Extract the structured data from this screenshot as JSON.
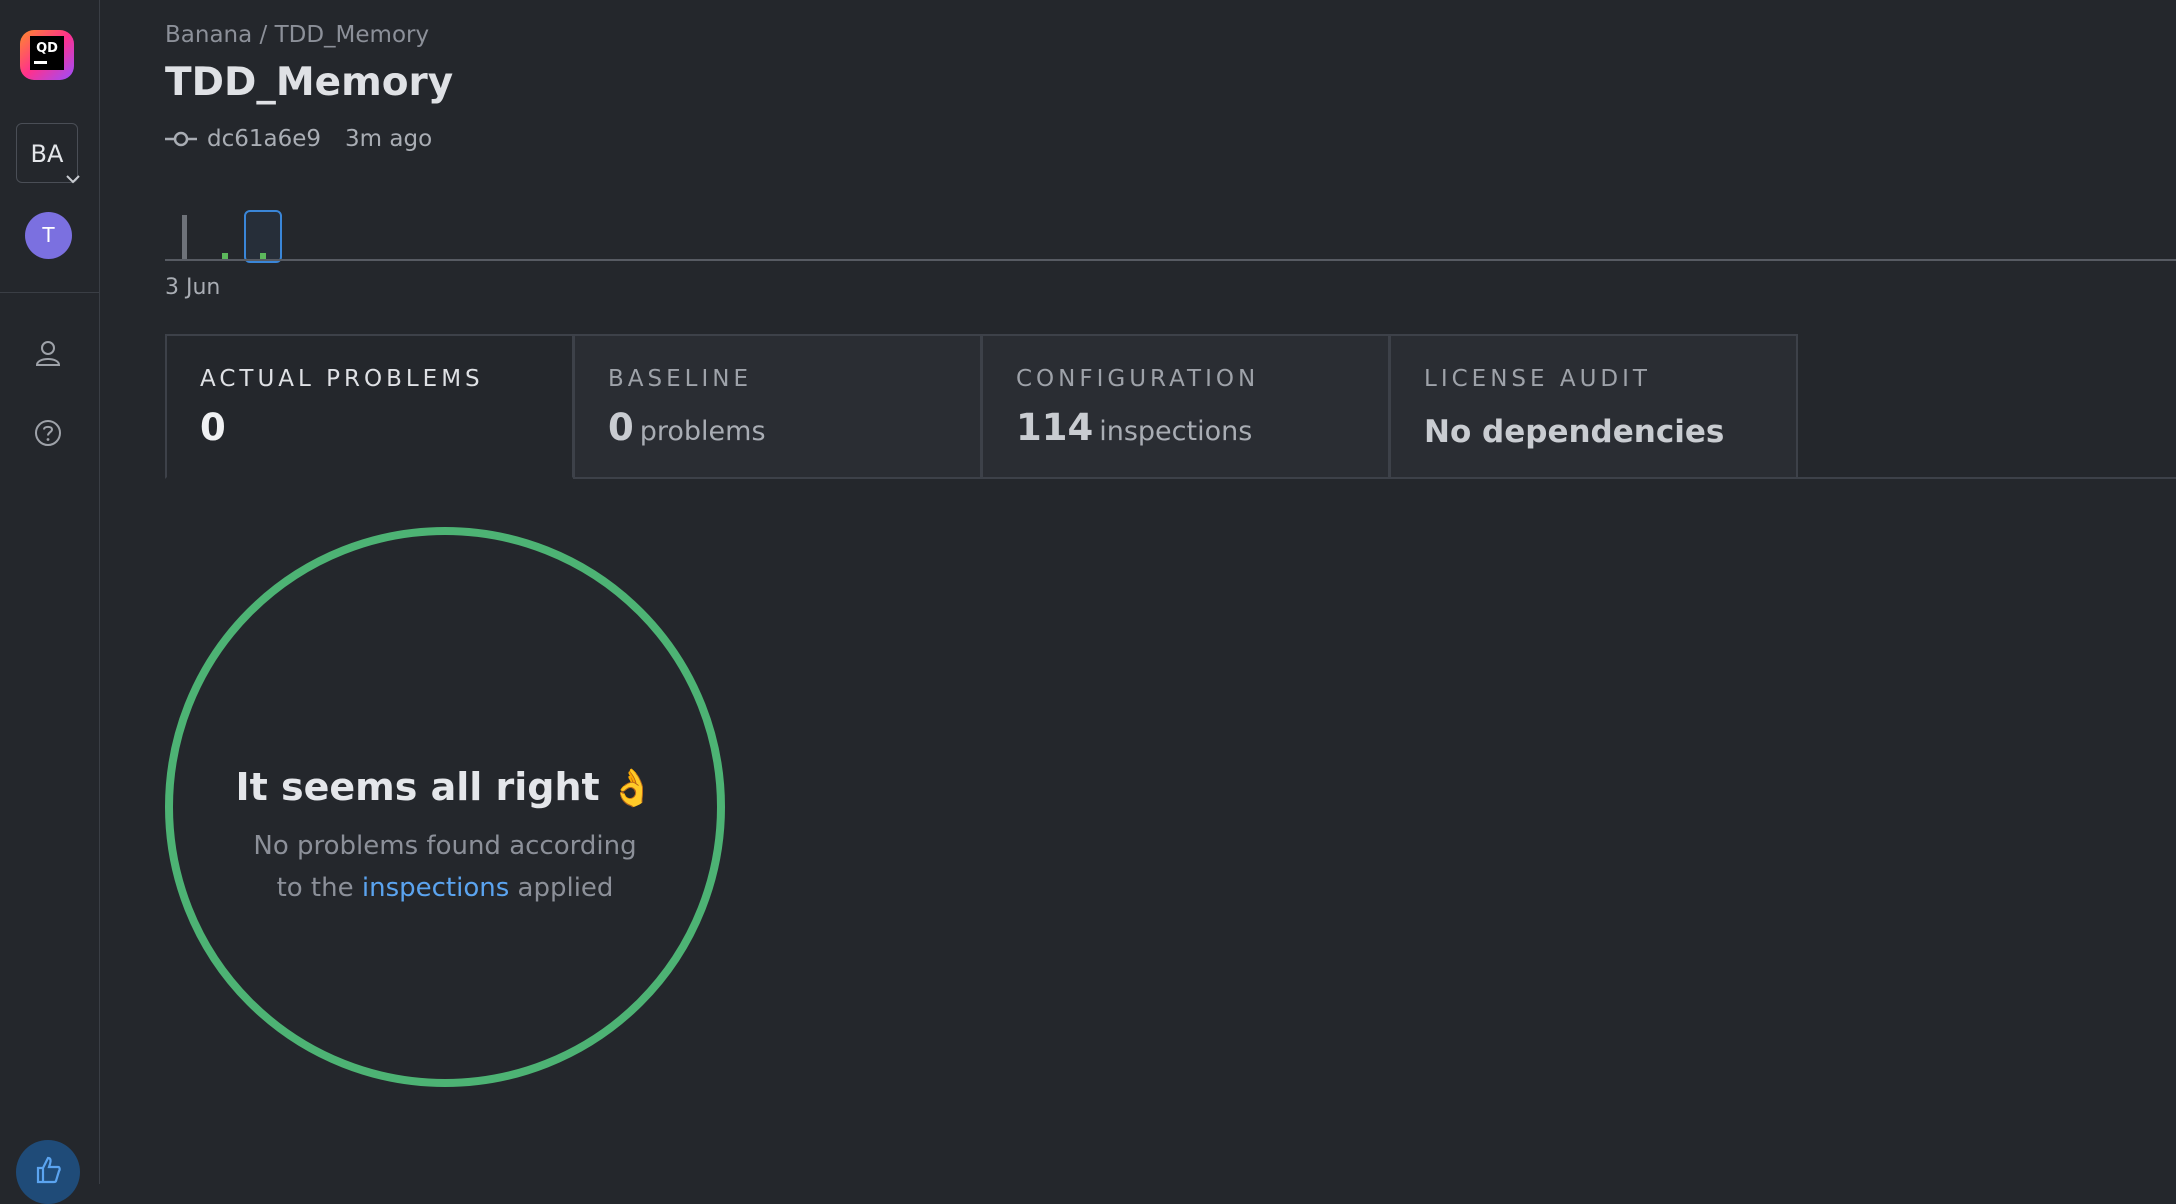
{
  "sidebar": {
    "org_initials": "BA",
    "avatar_initial": "T"
  },
  "header": {
    "breadcrumb": "Banana / TDD_Memory",
    "title": "TDD_Memory",
    "commit_hash": "dc61a6e9",
    "commit_time": "3m ago"
  },
  "timeline": {
    "date_label": "3 Jun"
  },
  "tabs": [
    {
      "title": "ACTUAL PROBLEMS",
      "value": "0",
      "unit": ""
    },
    {
      "title": "BASELINE",
      "value": "0",
      "unit": "problems"
    },
    {
      "title": "CONFIGURATION",
      "value": "114",
      "unit": "inspections"
    },
    {
      "title": "LICENSE AUDIT",
      "text": "No dependencies"
    }
  ],
  "empty_state": {
    "title": "It seems all right",
    "emoji": "👌",
    "desc_line1": "No problems found according",
    "desc_prefix": "to the",
    "link_text": "inspections",
    "desc_suffix": "applied"
  },
  "colors": {
    "background": "#24272c",
    "ok_green": "#4db374",
    "link_blue": "#5ba4f0",
    "accent_blue": "#3a86d8"
  }
}
